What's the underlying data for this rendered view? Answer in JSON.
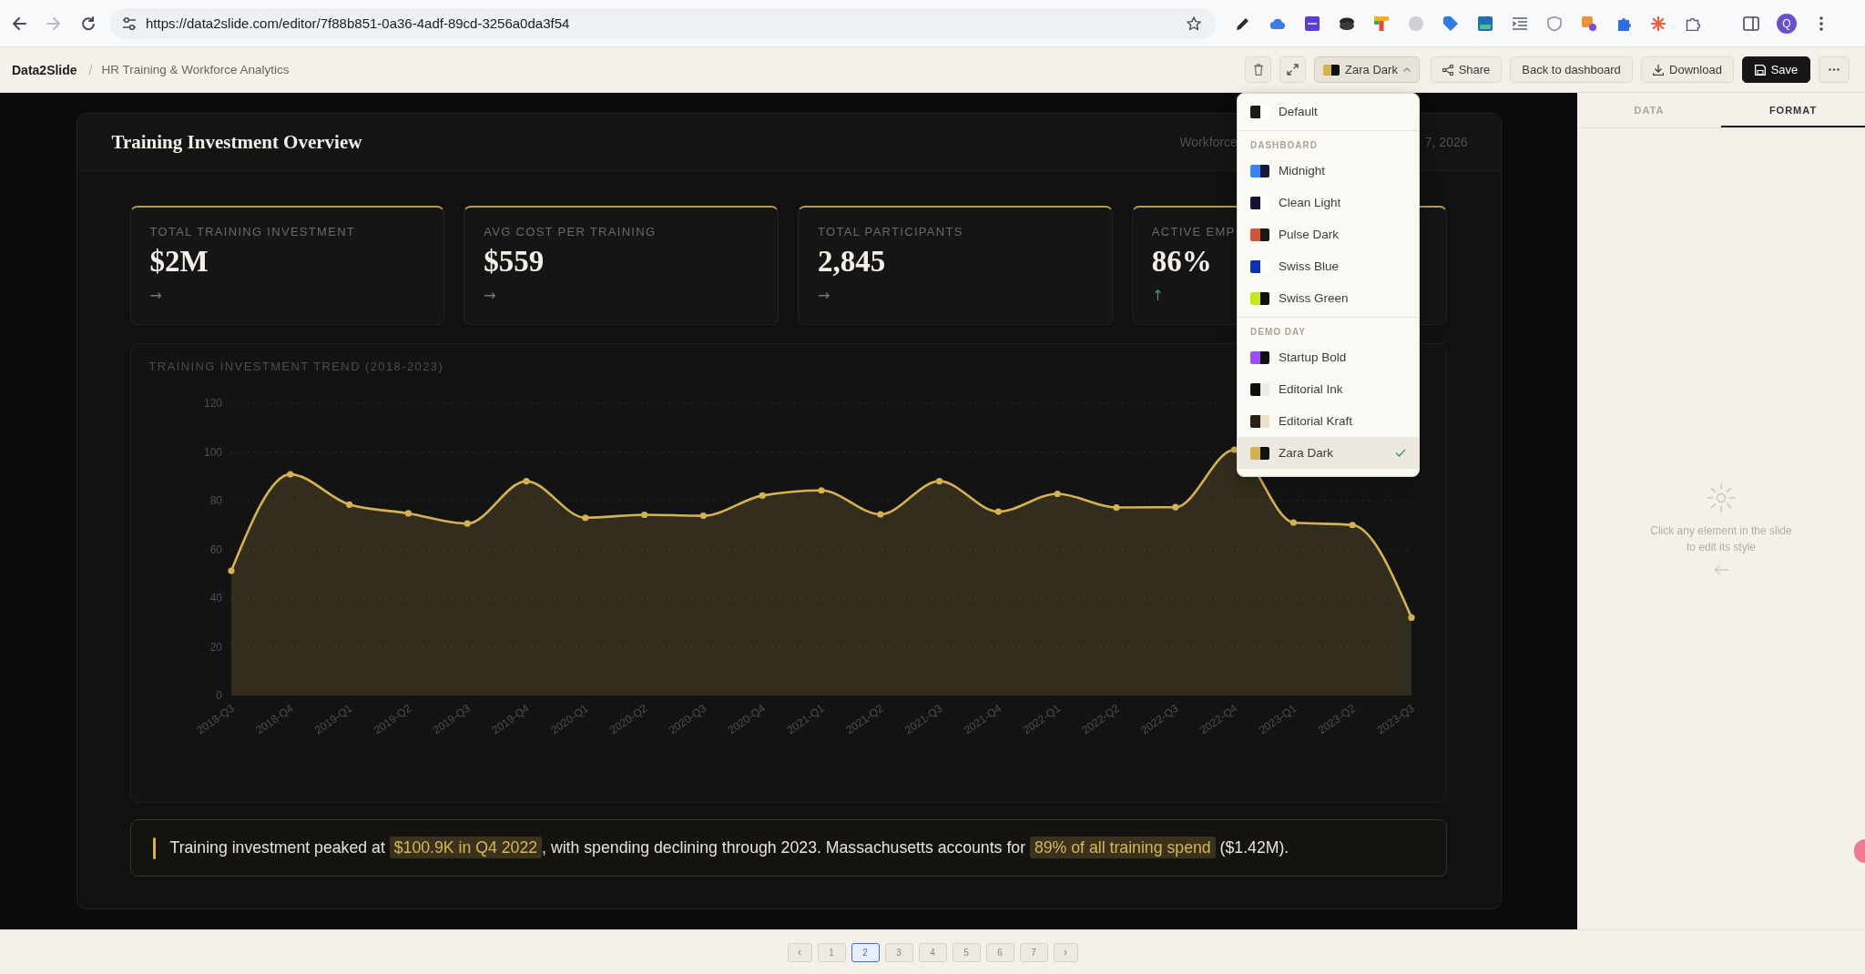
{
  "browser": {
    "nav_buttons": [
      {
        "kind": "back",
        "disabled": false
      },
      {
        "kind": "forward",
        "disabled": true
      },
      {
        "kind": "reload",
        "disabled": false
      }
    ],
    "url": "https://data2slide.com/editor/7f88b851-0a36-4adf-89cd-3256a0da3f54",
    "profile_initial": "Q"
  },
  "header": {
    "app_name": "Data2Slide",
    "separator": "/",
    "document_title": "HR Training & Workforce Analytics",
    "theme_button": {
      "label": "Zara Dark",
      "swatch": [
        {
          "color": "#d4b053"
        },
        {
          "color": "#111111"
        }
      ],
      "expanded": true
    },
    "buttons": [
      {
        "kind": "share",
        "label": "Share"
      },
      {
        "kind": "back",
        "label": "Back to dashboard"
      },
      {
        "kind": "download",
        "label": "Download"
      },
      {
        "kind": "save",
        "label": "Save"
      }
    ]
  },
  "theme_menu": {
    "sections": [
      {
        "items": [
          {
            "label": "Default",
            "swatch": [
              {
                "color": "#1e1a16"
              },
              {
                "color": "#ffffff"
              }
            ],
            "selected": false
          }
        ]
      },
      {
        "heading": "DASHBOARD",
        "items": [
          {
            "label": "Midnight",
            "swatch": [
              {
                "color": "#3b82f6"
              },
              {
                "color": "#151a3a"
              }
            ],
            "selected": false
          },
          {
            "label": "Clean Light",
            "swatch": [
              {
                "color": "#141432"
              },
              {
                "color": "#ffffff"
              }
            ],
            "selected": false
          },
          {
            "label": "Pulse Dark",
            "swatch": [
              {
                "color": "#d0583a"
              },
              {
                "color": "#1c1614"
              }
            ],
            "selected": false
          },
          {
            "label": "Swiss Blue",
            "swatch": [
              {
                "color": "#0b32b5"
              },
              {
                "color": "#ffffff"
              }
            ],
            "selected": false
          },
          {
            "label": "Swiss Green",
            "swatch": [
              {
                "color": "#c8e61a"
              },
              {
                "color": "#111111"
              }
            ],
            "selected": false
          }
        ]
      },
      {
        "heading": "DEMO DAY",
        "items": [
          {
            "label": "Startup Bold",
            "swatch": [
              {
                "color": "#9b4dff"
              },
              {
                "color": "#111111"
              }
            ],
            "selected": false
          },
          {
            "label": "Editorial Ink",
            "swatch": [
              {
                "color": "#0d0b0a"
              },
              {
                "color": "#ececec"
              }
            ],
            "selected": false
          },
          {
            "label": "Editorial Kraft",
            "swatch": [
              {
                "color": "#2a2018"
              },
              {
                "color": "#ece0cc"
              }
            ],
            "selected": false
          },
          {
            "label": "Zara Dark",
            "swatch": [
              {
                "color": "#d4b053"
              },
              {
                "color": "#111111"
              }
            ],
            "selected": true
          }
        ]
      }
    ]
  },
  "slide": {
    "title": "Training Investment Overview",
    "subtitle_fragments": [
      "Workforce",
      "7, 2026"
    ],
    "kpis": [
      {
        "label": "TOTAL TRAINING INVESTMENT",
        "value": "$2M",
        "trend": "→",
        "kind": "flat"
      },
      {
        "label": "AVG COST PER TRAINING",
        "value": "$559",
        "trend": "→",
        "kind": "flat"
      },
      {
        "label": "TOTAL PARTICIPANTS",
        "value": "2,845",
        "trend": "→",
        "kind": "flat"
      },
      {
        "label": "ACTIVE EMP",
        "value": "86%",
        "trend": "↑",
        "kind": "up"
      }
    ],
    "chart_data": {
      "type": "area",
      "title": "TRAINING INVESTMENT TREND (2018-2023)",
      "categories": [
        "2018-Q3",
        "2018-Q4",
        "2019-Q1",
        "2019-Q2",
        "2019-Q3",
        "2019-Q4",
        "2020-Q1",
        "2020-Q2",
        "2020-Q3",
        "2020-Q4",
        "2021-Q1",
        "2021-Q2",
        "2021-Q3",
        "2021-Q4",
        "2022-Q1",
        "2022-Q2",
        "2022-Q3",
        "2022-Q4",
        "2023-Q1",
        "2023-Q2",
        "2023-Q3"
      ],
      "series": [
        {
          "color": "#d4b254",
          "values": [
            51.2,
            90.8,
            78.4,
            74.8,
            70.6,
            88.0,
            73.0,
            74.2,
            73.8,
            82.1,
            84.2,
            74.4,
            88.0,
            75.5,
            82.8,
            77.2,
            77.3,
            100.9,
            71.0,
            70.0,
            32.0
          ]
        }
      ],
      "ylim": [
        0,
        120
      ],
      "yticks": [
        0,
        20,
        40,
        60,
        80,
        100,
        120
      ],
      "grid": true
    },
    "insight": {
      "segments": [
        {
          "text": "Training investment peaked at ",
          "highlighted": false
        },
        {
          "text": "$100.9K in Q4 2022",
          "highlighted": true
        },
        {
          "text": ", with spending declining through 2023. Massachusetts accounts for ",
          "highlighted": false
        },
        {
          "text": "89% of all training spend",
          "highlighted": true
        },
        {
          "text": " ($1.42M).",
          "highlighted": false
        }
      ]
    }
  },
  "side_panel": {
    "tabs": [
      {
        "label": "DATA",
        "selected": false
      },
      {
        "label": "FORMAT",
        "selected": true
      }
    ],
    "hint": "Click any element in the slide to edit its style"
  },
  "pagination": {
    "previous": "‹",
    "next": "›",
    "pages": [
      {
        "label": "1",
        "selected": false
      },
      {
        "label": "2",
        "selected": true
      },
      {
        "label": "3",
        "selected": false
      },
      {
        "label": "4",
        "selected": false
      },
      {
        "label": "5",
        "selected": false
      },
      {
        "label": "6",
        "selected": false
      },
      {
        "label": "7",
        "selected": false
      }
    ]
  }
}
